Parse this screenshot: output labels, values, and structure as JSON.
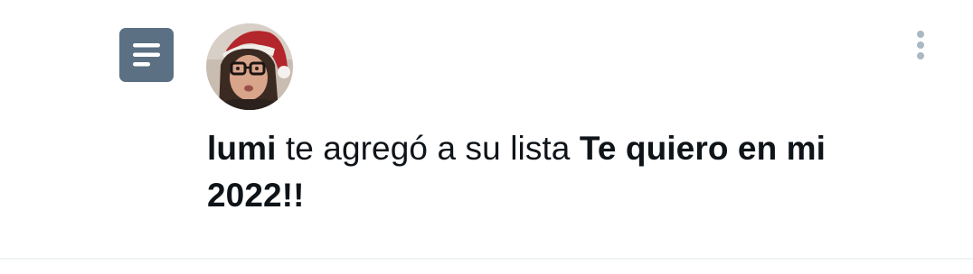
{
  "notification": {
    "type_icon": "list-icon",
    "avatar_icon": "user-avatar",
    "more_icon": "more-vertical-icon",
    "user_name": "lumi",
    "action_text": " te agregó a su lista ",
    "list_name": "Te quiero en mi 2022!!"
  },
  "colors": {
    "list_icon_bg": "#5b7083",
    "text": "#0f1419",
    "more_icon": "#aab8c2",
    "divider": "#eff3f4"
  }
}
